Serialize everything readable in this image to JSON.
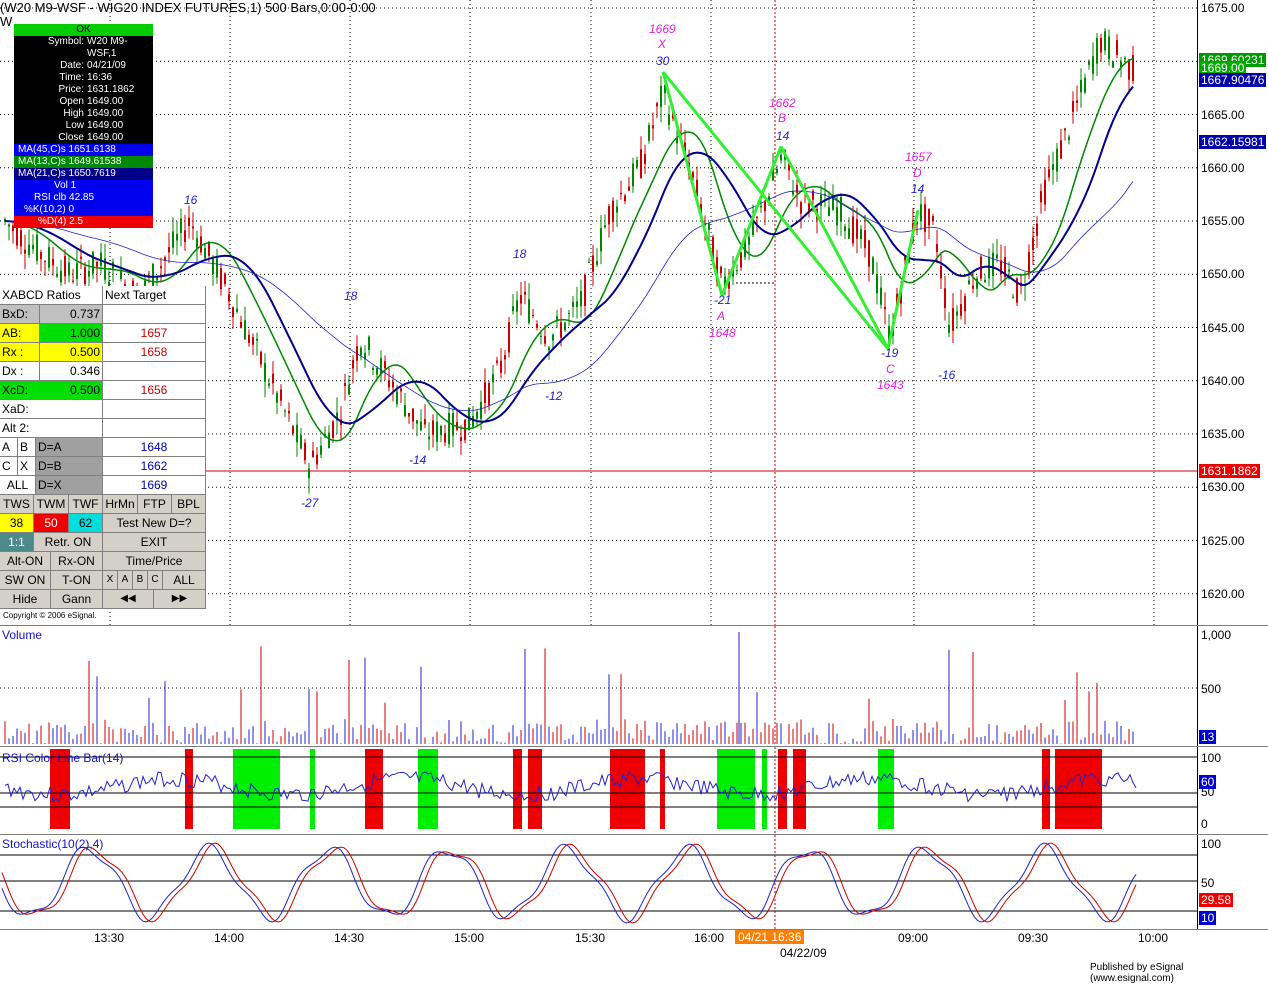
{
  "title": "(W20 M9-WSF - WIG20 INDEX FUTURES,1) 500 Bars,0:00-0:00",
  "subtitle_fragment": "W",
  "info_box": {
    "status": "OK",
    "rows": [
      {
        "k": "Symbol:",
        "v": "W20 M9-WSF,1"
      },
      {
        "k": "Date:",
        "v": "04/21/09"
      },
      {
        "k": "Time:",
        "v": "16:36"
      },
      {
        "k": "Price:",
        "v": "1631.1862"
      },
      {
        "k": "Open",
        "v": "1649.00"
      },
      {
        "k": "High",
        "v": "1649.00"
      },
      {
        "k": "Low",
        "v": "1649.00"
      },
      {
        "k": "Close",
        "v": "1649.00"
      }
    ],
    "ma45": "MA(45,C)s  1651.6138",
    "ma13": "MA(13,C)s  1649.61538",
    "ma21": "MA(21,C)s  1650.7619",
    "vol": "Vol  1",
    "rsi": "RSI clb  42.85",
    "k": "%K(10,2)  0",
    "d": "%D(4)  2.5"
  },
  "xabcd_panel": {
    "header": "XABCD Ratios",
    "header2": "Next Target",
    "rows": [
      {
        "a": "BxD:",
        "b": "0.737",
        "c": ""
      },
      {
        "a": "AB:",
        "b": "1.000",
        "c": "1657"
      },
      {
        "a": "Rx  :",
        "b": "0.500",
        "c": "1658"
      },
      {
        "a": "Dx  :",
        "b": "0.346",
        "c": ""
      },
      {
        "a": "XcD:",
        "b": "0.500",
        "c": "1656"
      },
      {
        "a": "XaD:",
        "b": "",
        "c": ""
      },
      {
        "a": "Alt 2:",
        "b": "",
        "c": ""
      }
    ],
    "d_rows": [
      {
        "p": "A",
        "q": "B",
        "r": "D=A",
        "v": "1648"
      },
      {
        "p": "C",
        "q": "X",
        "r": "D=B",
        "v": "1662"
      },
      {
        "p": "ALL",
        "q": "",
        "r": "D=X",
        "v": "1669"
      }
    ],
    "tws": [
      "TWS",
      "TWM",
      "TWF",
      "HrMn",
      "FTP",
      "BPL"
    ],
    "tws_vals": [
      "38",
      "50",
      "62"
    ],
    "test_new": "Test New D=?",
    "one_one": "1:1",
    "retr": "Retr. ON",
    "exit": "EXIT",
    "alt_on": "Alt-ON",
    "rx_on": "Rx-ON",
    "time_price": "Time/Price",
    "sw_on": "SW ON",
    "t_on": "T-ON",
    "letters": [
      "X",
      "A",
      "B",
      "C"
    ],
    "all": "ALL",
    "hide": "Hide",
    "gann": "Gann",
    "prev": "◀◀",
    "next": "▶▶",
    "copyright": "Copyright © 2006 eSignal."
  },
  "price_axis": {
    "labels": [
      "1675.00",
      "1670.00",
      "1665.00",
      "1660.00",
      "1655.00",
      "1650.00",
      "1645.00",
      "1640.00",
      "1635.00",
      "1630.00",
      "1625.00",
      "1620.00"
    ],
    "tags": [
      {
        "text": "1669.60231",
        "color": "#009900"
      },
      {
        "text": "1669.00",
        "color": "#00aa00"
      },
      {
        "text": "1667.90476",
        "color": "#0000aa"
      },
      {
        "text": "1662.15981",
        "color": "#0000aa"
      },
      {
        "text": "1631.1862",
        "color": "#ee0000"
      }
    ]
  },
  "volume": {
    "title": "Volume",
    "labels": [
      "1,000",
      "500"
    ],
    "tag": "13"
  },
  "rsi": {
    "title": "RSI Color Line Bar(14)",
    "labels": [
      "100",
      "50",
      "0"
    ],
    "tag": "60"
  },
  "stoch": {
    "title": "Stochastic(10(2),4)",
    "labels": [
      "100",
      "50"
    ],
    "tags": [
      "29.58",
      "10"
    ]
  },
  "time_axis": {
    "labels": [
      "13:30",
      "14:00",
      "14:30",
      "15:00",
      "15:30",
      "16:00",
      "09:00",
      "09:30",
      "10:00"
    ],
    "date": "04/22/09",
    "cursor": "04/21 16:36"
  },
  "annotations": {
    "x_price": "1669",
    "x_letter": "X",
    "x_num": "30",
    "b_price": "1662",
    "b_letter": "B",
    "b_num": "14",
    "a_num": "-21",
    "a_letter": "A",
    "a_price": "1648",
    "c_num": "-19",
    "c_letter": "C",
    "c_price": "1643",
    "d_price": "1657",
    "d_letter": "D",
    "d_num": "14",
    "swings": [
      "16",
      "18",
      "18",
      "-27",
      "-14",
      "-12",
      "-16"
    ]
  },
  "footer": "Published by eSignal (www.esignal.com)"
}
